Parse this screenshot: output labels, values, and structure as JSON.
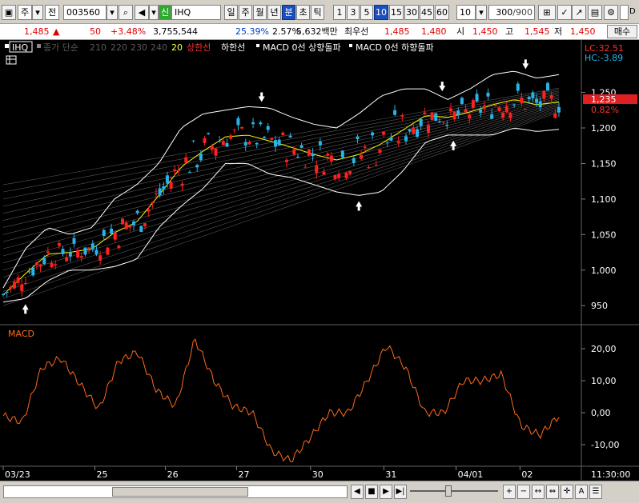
{
  "toolbar": {
    "period_label": "주",
    "market_label": "전",
    "code_value": "003560",
    "sin_badge": "신",
    "name_value": "IHQ",
    "period_buttons": [
      "일",
      "주",
      "월",
      "년",
      "분",
      "초",
      "틱"
    ],
    "selected_period": "분",
    "minute_buttons": [
      "1",
      "3",
      "5",
      "10",
      "15",
      "30",
      "45",
      "60"
    ],
    "selected_minute": "10",
    "minute_select": "10",
    "count_value": "300",
    "count_total": "/900",
    "check_label": "D",
    "extra_label": "04/"
  },
  "price_bar": {
    "price": "1,485",
    "change_arrow": "▲",
    "change": "50",
    "change_pct": "+3.48%",
    "volume": "3,755,544",
    "volume_pct": "25.39%",
    "turnover_pct": "2.57%",
    "amount": "5,632백만",
    "best_bid_label": "최우선",
    "best_ask": "1,485",
    "best_bid": "1,480",
    "open_label": "시",
    "open": "1,450",
    "high_label": "고",
    "high": "1,545",
    "low_label": "저",
    "low": "1,450",
    "order_button": "매수"
  },
  "legend": {
    "code_tag": "IHQ",
    "ma_label": "종가 단순",
    "ma_periods": [
      "210",
      "220",
      "230",
      "240"
    ],
    "ma_highlight": "20",
    "upper_band": "상한선",
    "lower_band": "하한선",
    "macd_up": "MACD 0선 상향돌파",
    "macd_down": "MACD 0선 하향돌파"
  },
  "price_panel": {
    "lc_label": "LC:32.51",
    "hc_label": "HC:-3.89",
    "current_price": "1,235",
    "current_pct": "0.82%",
    "y_ticks": [
      "1,250",
      "1,200",
      "1,150",
      "1,100",
      "1,050",
      "1,000",
      "950"
    ],
    "colors": {
      "up": "#ff2020",
      "down": "#28b4e6",
      "band": "#ffffff",
      "ma": "#ffff00"
    }
  },
  "macd_panel": {
    "title": "MACD",
    "y_ticks": [
      "20,00",
      "10,00",
      "0,00",
      "-10,00"
    ],
    "line_color": "#ff6a1a"
  },
  "x_axis": {
    "labels": [
      "03/23",
      "25",
      "26",
      "27",
      "30",
      "31",
      "04/01",
      "02"
    ],
    "time_label": "11:30:00"
  },
  "chart_data": [
    {
      "type": "line",
      "title": "",
      "series": [
        {
          "name": "상한선",
          "values": [
            975,
            1030,
            1060,
            1050,
            1060,
            1100,
            1120,
            1150,
            1200,
            1220,
            1225,
            1230,
            1228,
            1215,
            1205,
            1200,
            1220,
            1245,
            1255,
            1255,
            1240,
            1255,
            1275,
            1280,
            1270,
            1275
          ]
        },
        {
          "name": "하한선",
          "values": [
            955,
            960,
            985,
            1000,
            1000,
            1005,
            1015,
            1060,
            1090,
            1115,
            1150,
            1150,
            1135,
            1130,
            1120,
            1110,
            1105,
            1110,
            1140,
            1180,
            1190,
            1190,
            1190,
            1200,
            1195,
            1198
          ]
        }
      ],
      "ylim": [
        930,
        1290
      ]
    },
    {
      "type": "line",
      "title": "",
      "series": [
        {
          "name": "MACD",
          "values": [
            -1,
            -3,
            14,
            17,
            9,
            1,
            16,
            19,
            7,
            2,
            23,
            10,
            2,
            0,
            -12,
            -15,
            -8,
            0,
            0,
            10,
            21,
            14,
            0,
            0,
            10,
            10,
            12,
            -4,
            -7,
            -1
          ]
        }
      ],
      "ylim": [
        -16,
        26
      ]
    }
  ]
}
